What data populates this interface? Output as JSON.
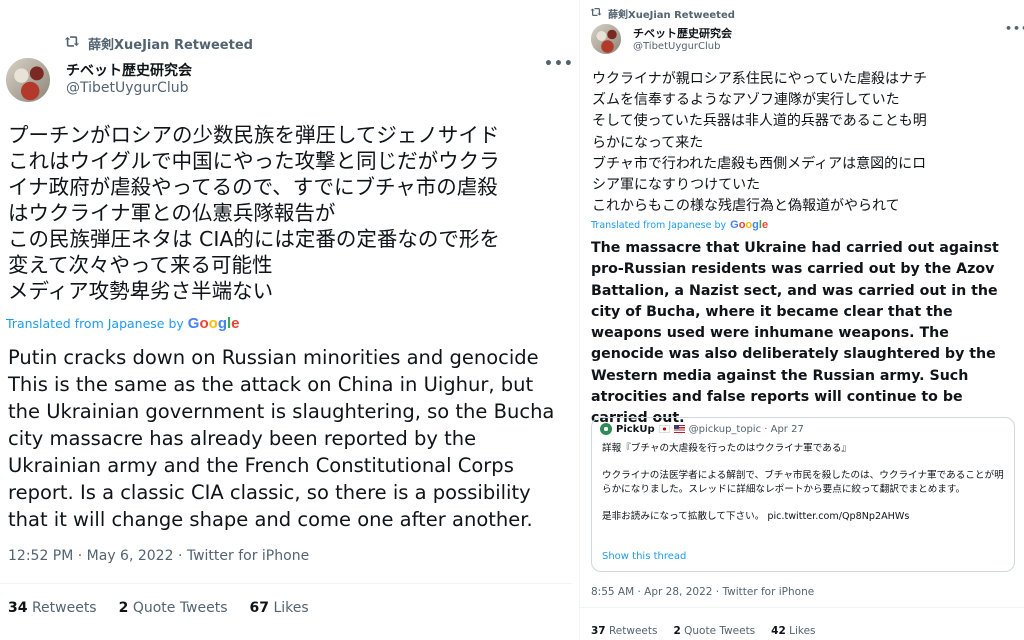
{
  "left": {
    "retweet_label": "薛剣XueJian Retweeted",
    "author_name": "チベット歴史研究会",
    "author_handle": "@TibetUygurClub",
    "more": "•••",
    "text_ja": "プーチンがロシアの少数民族を弾圧してジェノサイド\nこれはウイグルで中国にやった攻撃と同じだがウクラ\nイナ政府が虐殺やってるので、すでにブチャ市の虐殺\nはウクライナ軍との仏憲兵隊報告が\nこの民族弾圧ネタは CIA的には定番の定番なので形を\n変えて次々やって来る可能性\nメディア攻勢卑劣さ半端ない",
    "translated_label": "Translated from Japanese by",
    "text_en": "Putin cracks down on Russian minorities and genocide This is the same as the attack on China in Uighur, but the Ukrainian government is slaughtering, so the Bucha city massacre has already been reported by the Ukrainian army and the French Constitutional Corps report. Is a classic CIA classic, so there is a possibility that it will change shape and come one after another.",
    "timestamp": "12:52 PM · May 6, 2022 · Twitter for iPhone",
    "stats": {
      "retweets_count": "34",
      "retweets_label": "Retweets",
      "quotes_count": "2",
      "quotes_label": "Quote Tweets",
      "likes_count": "67",
      "likes_label": "Likes"
    }
  },
  "right": {
    "retweet_label": "薛剣XueJian Retweeted",
    "author_name": "チベット歴史研究会",
    "author_handle": "@TibetUygurClub",
    "more": "•••",
    "text_ja": "ウクライナが親ロシア系住民にやっていた虐殺はナチ\nズムを信奉するようなアゾフ連隊が実行していた\nそして使っていた兵器は非人道的兵器であることも明\nらかになって来た\nブチャ市で行われた虐殺も西側メディアは意図的にロ\nシア軍になすりつけていた\nこれからもこの様な残虐行為と偽報道がやられて",
    "translated_label": "Translated from Japanese by",
    "text_en": "The massacre that Ukraine had carried out against pro-Russian residents was carried out by the Azov Battalion, a Nazist sect, and was carried out in the city of Bucha, where it became clear that the weapons used were inhumane weapons. The genocide was also deliberately slaughtered by the Western media against the Russian army. Such atrocities and false reports will continue to be carried out.",
    "quote": {
      "name": "PickUp",
      "handle_date": "@pickup_topic · Apr 27",
      "text": "詳報『ブチャの大虐殺を行ったのはウクライナ軍である』\n\nウクライナの法医学者による解剖で、ブチャ市民を殺したのは、ウクライナ軍であることが明らかになりました。スレッドに詳細なレポートから要点に絞って翻訳でまとめます。\n\n是非お読みになって拡散して下さい。 pic.twitter.com/Qp8Np2AHWs",
      "show_thread": "Show this thread"
    },
    "timestamp": "8:55 AM · Apr 28, 2022 · Twitter for iPhone",
    "stats": {
      "retweets_count": "37",
      "retweets_label": "Retweets",
      "quotes_count": "2",
      "quotes_label": "Quote Tweets",
      "likes_count": "42",
      "likes_label": "Likes"
    }
  },
  "google_logo": "Google",
  "colors": {
    "link_blue": "#1d9bf0",
    "muted": "#536471",
    "text": "#0f1419",
    "border": "#cfd9de"
  },
  "icons": {
    "retweet": "retweet-icon",
    "more": "more-icon"
  }
}
